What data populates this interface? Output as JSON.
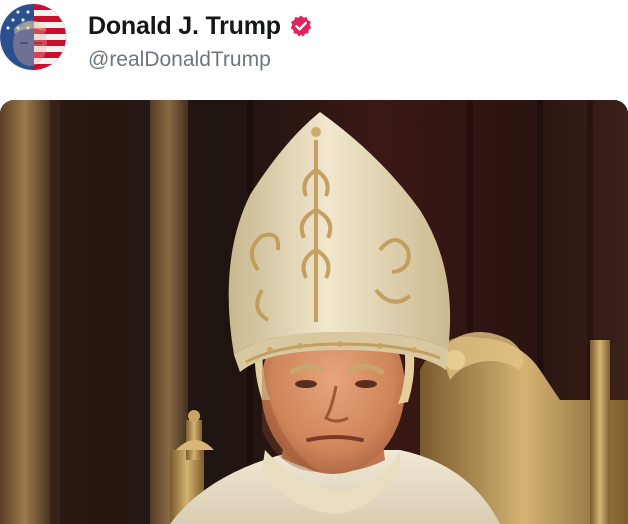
{
  "post": {
    "author": {
      "display_name": "Donald J. Trump",
      "handle": "@realDonaldTrump",
      "verified": true,
      "avatar_icon": "flag-portrait-avatar"
    },
    "media": {
      "type": "image",
      "subject": "man in white papal mitre and robes seated on ornate gold throne"
    }
  },
  "colors": {
    "name_text": "#14171a",
    "handle_text": "#6e767d",
    "verified_badge": "#e0245e",
    "mitre": "#e9ddc0",
    "mitre_embroidery": "#c9a96a",
    "throne_gold": "#b99755",
    "curtain_red": "#3e1a16"
  }
}
